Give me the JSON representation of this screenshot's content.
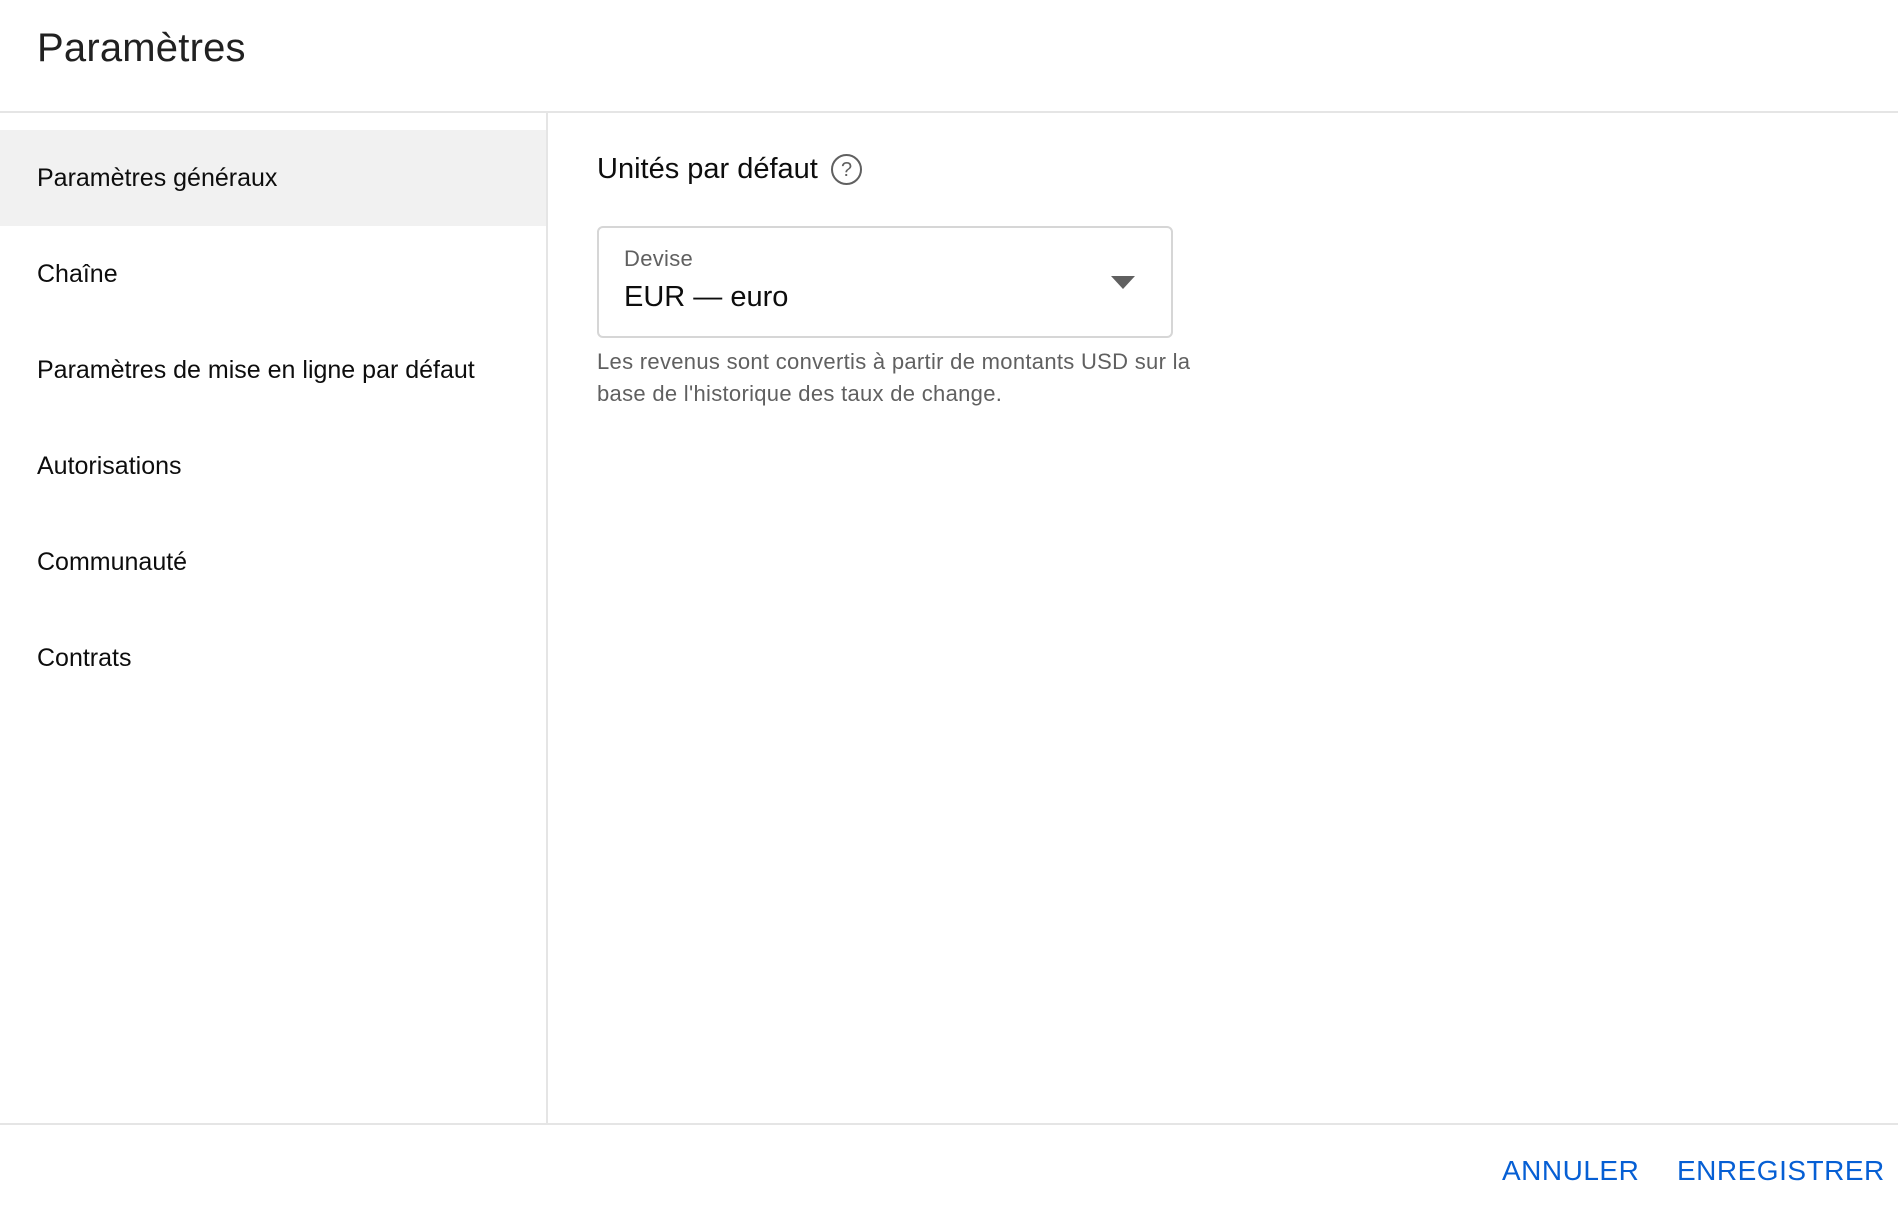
{
  "header": {
    "title": "Paramètres"
  },
  "sidebar": {
    "items": [
      {
        "label": "Paramètres généraux",
        "active": true
      },
      {
        "label": "Chaîne",
        "active": false
      },
      {
        "label": "Paramètres de mise en ligne par défaut",
        "active": false
      },
      {
        "label": "Autorisations",
        "active": false
      },
      {
        "label": "Communauté",
        "active": false
      },
      {
        "label": "Contrats",
        "active": false
      }
    ]
  },
  "main": {
    "section_title": "Unités par défaut",
    "help_icon": "help-circle-icon",
    "currency_select": {
      "label": "Devise",
      "value": "EUR — euro",
      "icon": "dropdown-arrow-icon"
    },
    "helper_text": "Les revenus sont convertis à partir de montants USD sur la base de l'historique des taux de change."
  },
  "footer": {
    "cancel_label": "ANNULER",
    "save_label": "ENREGISTRER"
  },
  "colors": {
    "accent": "#065fd4",
    "active_bg": "#f1f1f1",
    "divider": "#e5e5e5",
    "secondary_text": "#606060"
  }
}
